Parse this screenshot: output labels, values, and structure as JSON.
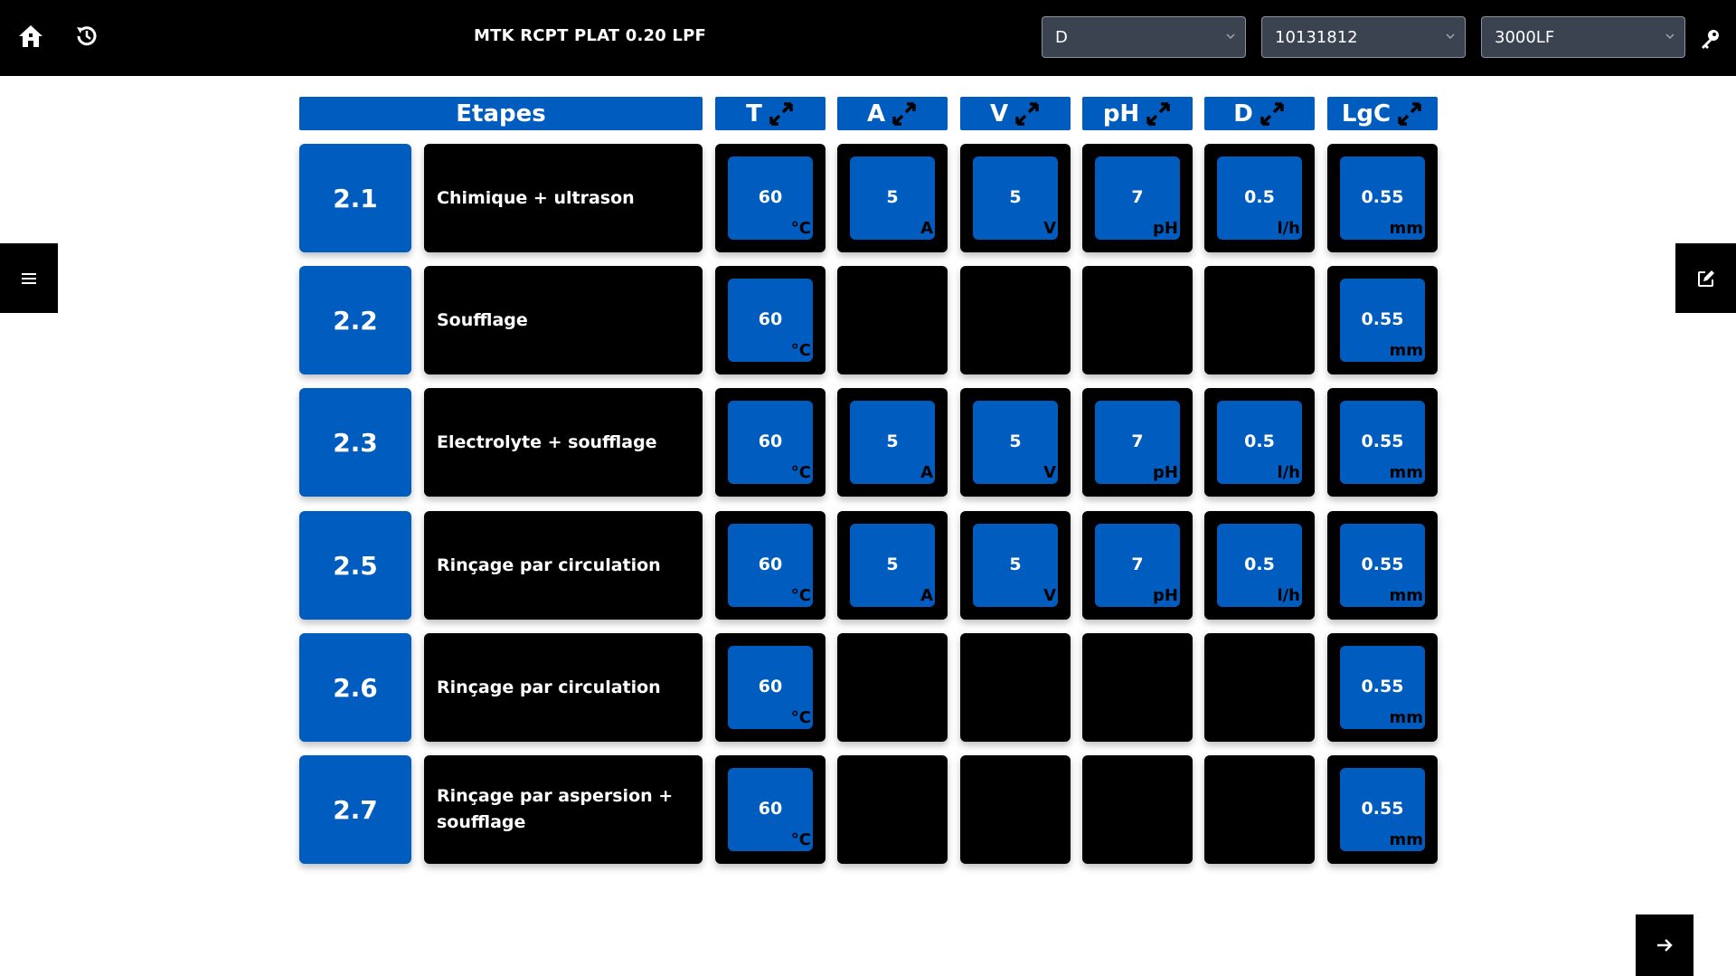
{
  "header": {
    "title": "MTK RCPT PLAT 0.20 LPF",
    "select_1": "D",
    "select_2": "10131812",
    "select_3": "3000LF"
  },
  "table": {
    "steps_header": "Etapes",
    "columns": [
      {
        "label": "T",
        "unit": "°C"
      },
      {
        "label": "A",
        "unit": "A"
      },
      {
        "label": "V",
        "unit": "V"
      },
      {
        "label": "pH",
        "unit": "pH"
      },
      {
        "label": "D",
        "unit": "l/h"
      },
      {
        "label": "LgC",
        "unit": "mm"
      }
    ],
    "rows": [
      {
        "num": "2.1",
        "name": "Chimique + ultrason",
        "values": [
          "60",
          "5",
          "5",
          "7",
          "0.5",
          "0.55"
        ]
      },
      {
        "num": "2.2",
        "name": "Soufflage",
        "values": [
          "60",
          null,
          null,
          null,
          null,
          "0.55"
        ]
      },
      {
        "num": "2.3",
        "name": "Electrolyte + soufflage",
        "values": [
          "60",
          "5",
          "5",
          "7",
          "0.5",
          "0.55"
        ]
      },
      {
        "num": "2.5",
        "name": "Rinçage par circulation",
        "values": [
          "60",
          "5",
          "5",
          "7",
          "0.5",
          "0.55"
        ]
      },
      {
        "num": "2.6",
        "name": "Rinçage par circulation",
        "values": [
          "60",
          null,
          null,
          null,
          null,
          "0.55"
        ]
      },
      {
        "num": "2.7",
        "name": "Rinçage par aspersion + soufflage",
        "values": [
          "60",
          null,
          null,
          null,
          null,
          "0.55"
        ]
      }
    ]
  },
  "icons": {
    "home": "home-icon",
    "history": "history-icon",
    "key": "key-icon",
    "menu": "menu-icon",
    "edit": "edit-icon",
    "next": "arrow-right-icon",
    "expand": "expand-icon",
    "chevron": "chevron-down-icon"
  },
  "colors": {
    "accent": "#005cbf",
    "bar": "#000000",
    "select_bg": "#3b4350"
  }
}
